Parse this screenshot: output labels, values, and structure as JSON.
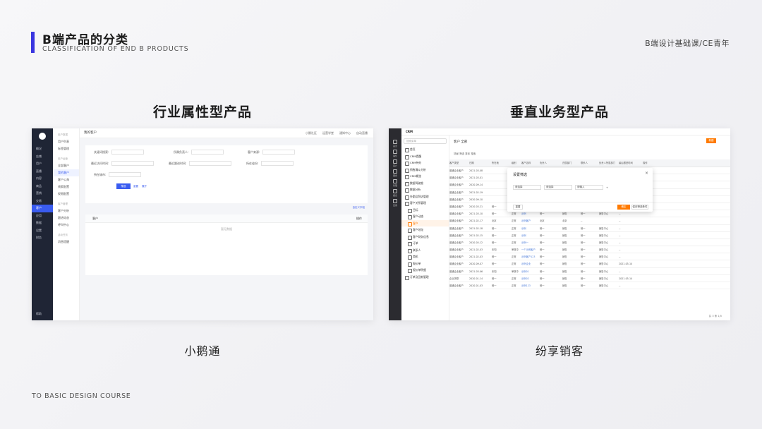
{
  "slide": {
    "title": "B端产品的分类",
    "subtitle": "CLASSIFICATION OF END B PRODUCTS",
    "brand": "B端设计基础课/CE青年",
    "footer": "TO BASIC DESIGN COURSE",
    "accent_color": "#3a36e0"
  },
  "left": {
    "heading": "行业属性型产品",
    "caption": "小鹅通",
    "screenshot": {
      "page_title": "我的客户",
      "topbar": [
        "小鹅社区",
        "运营学堂",
        "通知中心",
        "自动直播"
      ],
      "nav": [
        "概况",
        "店铺",
        "用户",
        "直播",
        "内容",
        "商品",
        "营销",
        "交易",
        "客户",
        "应用",
        "数据",
        "设置",
        "财务"
      ],
      "nav_active": "客户",
      "nav_bottom": "帮助",
      "sub": [
        "用户数据",
        "用户列表",
        "标签管理",
        "用户运营",
        "全部客户",
        "我的客户",
        "客户公海",
        "线索配置",
        "权限配置",
        "客户管理",
        "客户分析",
        "跟进动态",
        "呼叫中心",
        "活动任务",
        "消息提醒"
      ],
      "sub_active": "我的客户",
      "filters": [
        "关键词搜索:",
        "所属负责人:",
        "客户来源:",
        "最近访问时间:",
        "最近跟进时间:",
        "所在省份:",
        "所在城市:"
      ],
      "search_btn": "筛选",
      "reset_link": "重置",
      "expand_link": "展开",
      "custom_link": "自定义字段",
      "col_customer": "客户",
      "col_action": "操作",
      "empty": "暂无数据"
    }
  },
  "right": {
    "heading": "垂直业务型产品",
    "caption": "纷享销客",
    "screenshot": {
      "app": "CRM",
      "search_placeholder": "搜索菜单",
      "nav": [
        "首页",
        "销售",
        "客户",
        "服务",
        "管理",
        "报表",
        "应用"
      ],
      "side": [
        "首页",
        "CRM提醒",
        "CRM待办",
        "销售漏斗分析",
        "CRM概览",
        "数据驾驶舱",
        "数据分析",
        "外勤及拜访管理",
        "客户关系管理",
        "目标",
        "客户动态",
        "客户",
        "客户地址",
        "客户财务信息",
        "订单",
        "联系人",
        "商机",
        "报价单",
        "报价单明细",
        "订单及回款管理"
      ],
      "side_active": "客户",
      "header": "客户  全部",
      "new_btn": "新建",
      "toolbar": "场景  筛选  排序  搜索",
      "columns": [
        "客户类型",
        "日期",
        "所在地",
        "级别",
        "客户名称",
        "负责人",
        "归属部门",
        "联系人",
        "负责人所属部门",
        "最后跟进时间",
        "操作"
      ],
      "rows": [
        [
          "普通企业客户",
          "2021-03-08",
          "",
          "",
          "",
          "",
          "",
          "",
          "",
          "",
          ""
        ],
        [
          "普通企业客户",
          "2021-03-01",
          "",
          "",
          "",
          "",
          "",
          "",
          "",
          "",
          ""
        ],
        [
          "普通企业客户",
          "2020-09-14",
          "",
          "",
          "",
          "",
          "",
          "",
          "",
          "2021-05-24",
          ""
        ],
        [
          "普通企业客户",
          "2021-02-19",
          "",
          "",
          "",
          "",
          "",
          "",
          "",
          "",
          ""
        ],
        [
          "普通企业客户",
          "2020-09-10",
          "",
          "",
          "",
          "",
          "",
          "",
          "",
          "",
          ""
        ],
        [
          "普通企业客户",
          "2020-03-21",
          "杨一",
          "正常",
          "示例科技公司",
          "杨一",
          "销售",
          "杨一",
          "销售中心",
          "--",
          ""
        ],
        [
          "普通企业客户",
          "2021-03-10",
          "杨一",
          "正常",
          "示例",
          "杨一",
          "销售",
          "杨一",
          "销售中心",
          "--",
          ""
        ],
        [
          "普通企业客户",
          "2021-02-17",
          "北京",
          "正常",
          "示例客户",
          "北京",
          "北京",
          "--",
          "",
          "--",
          ""
        ],
        [
          "普通企业客户",
          "2021-02-18",
          "杨一",
          "正常",
          "示例",
          "杨一",
          "销售",
          "杨一",
          "销售中心",
          "--",
          ""
        ],
        [
          "普通企业客户",
          "2021-02-15",
          "杨一",
          "正常",
          "示例",
          "杨一",
          "销售",
          "杨一",
          "销售中心",
          "--",
          ""
        ],
        [
          "普通企业客户",
          "2020-05-12",
          "杨一",
          "正常",
          "示例一",
          "杨一",
          "销售",
          "杨一",
          "销售中心",
          "--",
          ""
        ],
        [
          "普通企业客户",
          "2021-02-03",
          "未知",
          "审核中",
          "一个示例客户",
          "杨一",
          "销售",
          "杨一",
          "销售中心",
          "--",
          ""
        ],
        [
          "普通企业客户",
          "2021-02-03",
          "杨一",
          "正常",
          "示例客户123",
          "杨一",
          "销售",
          "杨一",
          "销售中心",
          "--",
          ""
        ],
        [
          "普通企业客户",
          "2020-09-07",
          "杨一",
          "正常",
          "示例企业",
          "杨一",
          "销售",
          "杨一",
          "销售中心",
          "2021-05-14",
          ""
        ],
        [
          "普通企业客户",
          "2021-03-06",
          "未知",
          "审核中",
          "示例01",
          "杨一",
          "销售",
          "杨一",
          "销售中心",
          "--",
          ""
        ],
        [
          "企业关联",
          "2020-01-14",
          "杨一",
          "正常",
          "示例02",
          "杨一",
          "销售",
          "杨一",
          "销售中心",
          "2021-05-14",
          ""
        ],
        [
          "普通企业客户",
          "2020-01-03",
          "杨一",
          "正常",
          "示例123",
          "杨一",
          "销售",
          "杨一",
          "销售中心",
          "--",
          ""
        ]
      ],
      "dialog": {
        "title": "设置筛选",
        "field": "请选择",
        "operator": "请选择",
        "value": "请输入",
        "add": "+",
        "clear": "重置",
        "ok": "确定",
        "save": "保存筛选条件"
      },
      "pager": "共 3 条   1/5"
    }
  }
}
